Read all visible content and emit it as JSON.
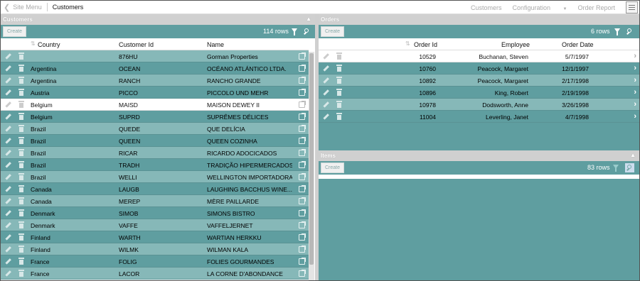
{
  "topnav": {
    "back_label": "Site Menu",
    "crumb": "Customers",
    "menu": [
      "Customers",
      "Configuration",
      "Order Report"
    ]
  },
  "customers": {
    "title": "Customers",
    "create_label": "Create",
    "rows_label": "114 rows",
    "columns": [
      "Country",
      "Customer Id",
      "Name"
    ],
    "rows": [
      {
        "country": "",
        "id": "876HU",
        "name": "Gorman Properties"
      },
      {
        "country": "Argentina",
        "id": "OCEAN",
        "name": "OCÉANO ATLÁNTICO LTDA."
      },
      {
        "country": "Argentina",
        "id": "RANCH",
        "name": "RANCHO GRANDE"
      },
      {
        "country": "Austria",
        "id": "PICCO",
        "name": "PICCOLO UND MEHR"
      },
      {
        "country": "Belgium",
        "id": "MAISD",
        "name": "MAISON DEWEY II"
      },
      {
        "country": "Belgium",
        "id": "SUPRD",
        "name": "SUPRÊMES DÉLICES"
      },
      {
        "country": "Brazil",
        "id": "QUEDE",
        "name": "QUE DELÍCIA"
      },
      {
        "country": "Brazil",
        "id": "QUEEN",
        "name": "QUEEN COZINHA"
      },
      {
        "country": "Brazil",
        "id": "RICAR",
        "name": "RICARDO ADOCICADOS"
      },
      {
        "country": "Brazil",
        "id": "TRADH",
        "name": "TRADIÇÃO HIPERMERCADOS"
      },
      {
        "country": "Brazil",
        "id": "WELLI",
        "name": "WELLINGTON IMPORTADORA"
      },
      {
        "country": "Canada",
        "id": "LAUGB",
        "name": "LAUGHING BACCHUS WINE..."
      },
      {
        "country": "Canada",
        "id": "MEREP",
        "name": "MÈRE PAILLARDE"
      },
      {
        "country": "Denmark",
        "id": "SIMOB",
        "name": "SIMONS BISTRO"
      },
      {
        "country": "Denmark",
        "id": "VAFFE",
        "name": "VAFFELJERNET"
      },
      {
        "country": "Finland",
        "id": "WARTH",
        "name": "WARTIAN HERKKU"
      },
      {
        "country": "Finland",
        "id": "WILMK",
        "name": "WILMAN KALA"
      },
      {
        "country": "France",
        "id": "FOLIG",
        "name": "FOLIES GOURMANDES"
      },
      {
        "country": "France",
        "id": "LACOR",
        "name": "LA CORNE D'ABONDANCE"
      }
    ]
  },
  "orders": {
    "title": "Orders",
    "create_label": "Create",
    "rows_label": "6 rows",
    "columns": [
      "Order Id",
      "Employee",
      "Order Date"
    ],
    "rows": [
      {
        "id": "10529",
        "employee": "Buchanan, Steven",
        "date": "5/7/1997"
      },
      {
        "id": "10760",
        "employee": "Peacock, Margaret",
        "date": "12/1/1997"
      },
      {
        "id": "10892",
        "employee": "Peacock, Margaret",
        "date": "2/17/1998"
      },
      {
        "id": "10896",
        "employee": "King, Robert",
        "date": "2/19/1998"
      },
      {
        "id": "10978",
        "employee": "Dodsworth, Anne",
        "date": "3/26/1998"
      },
      {
        "id": "11004",
        "employee": "Leverling, Janet",
        "date": "4/7/1998"
      }
    ]
  },
  "items": {
    "title": "Items",
    "create_label": "Create",
    "rows_label": "83 rows"
  },
  "colors": {
    "teal_dark": "#5f9ea0",
    "teal_light": "#86b8b8",
    "header_grey": "#d0d0d0"
  },
  "icons": [
    "chevron-left-icon",
    "hamburger-menu-icon",
    "pin-icon",
    "filter-icon",
    "search-icon",
    "pencil-icon",
    "trash-icon",
    "external-link-icon",
    "chevron-right-icon",
    "sort-icon"
  ]
}
